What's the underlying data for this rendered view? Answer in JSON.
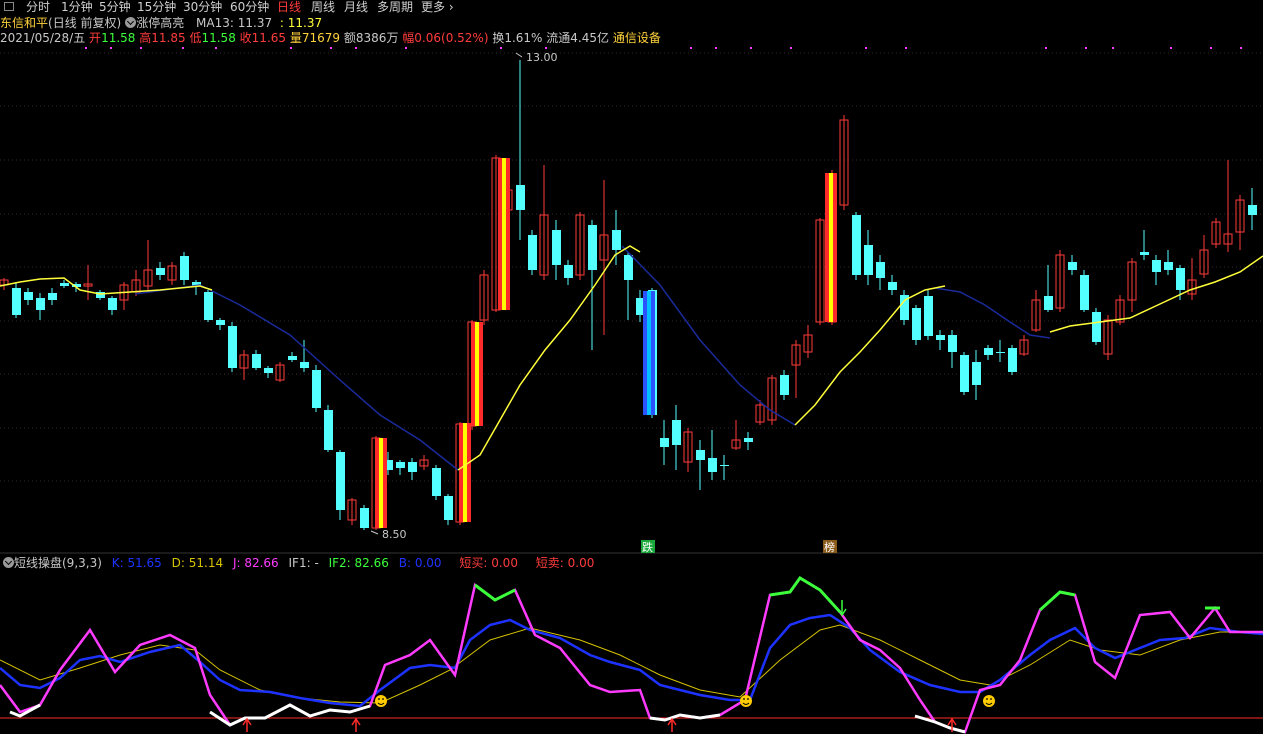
{
  "toolbar": {
    "tabs": [
      "分时",
      "1分钟",
      "5分钟",
      "15分钟",
      "30分钟",
      "60分钟",
      "日线",
      "周线",
      "月线",
      "多周期",
      "更多"
    ],
    "active": "日线"
  },
  "header": {
    "stock_name": "东信和平",
    "mode": "(日线 前复权)",
    "limit_label": "涨停高亮",
    "ma_label": "MA13: 11.37",
    "ma_value2": ": 11.37"
  },
  "quote": {
    "date": "2021/05/28/五",
    "open_label": "开",
    "open": "11.58",
    "high_label": "高",
    "high": "11.85",
    "low_label": "低",
    "low": "11.58",
    "close_label": "收",
    "close": "11.65",
    "vol_label": "量",
    "vol": "71679",
    "amt_label": "额",
    "amt": "8386万",
    "chg_label": "幅",
    "chg": "0.06(0.52%)",
    "turnover": "换1.61%",
    "float": "流通4.45亿",
    "sector": "通信设备"
  },
  "price_labels": {
    "high": "13.00",
    "low": "8.50"
  },
  "markers": {
    "down": "跌",
    "rank": "榜"
  },
  "indicator": {
    "name": "短线操盘(9,3,3)",
    "k": "K: 51.65",
    "d": "D: 51.14",
    "j": "J: 82.66",
    "if1": "IF1: -",
    "if2": "IF2: 82.66",
    "b": "B: 0.00",
    "buy": "短买: 0.00",
    "sell": "短卖: 0.00"
  },
  "colors": {
    "up": "#ff3b3b",
    "down": "#54ffff",
    "ma_yellow": "#ffff3b",
    "ma_navy": "#1a2a9a",
    "k": "#1e32ff",
    "d": "#d6c200",
    "j": "#ff3bff",
    "green": "#3bff3b"
  },
  "chart_data": {
    "type": "candlestick",
    "ylim": [
      8.5,
      13.0
    ],
    "annotations": [
      "13.00",
      "8.50"
    ]
  }
}
